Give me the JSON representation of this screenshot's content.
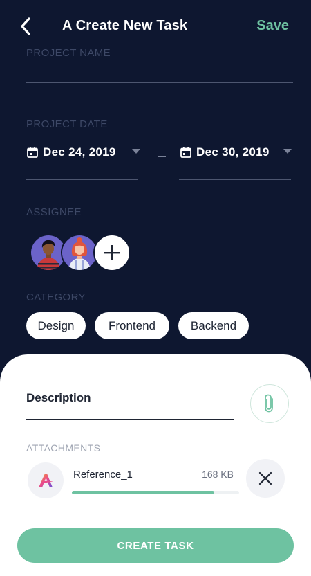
{
  "header": {
    "title": "A Create New Task",
    "save_label": "Save",
    "back_icon": "chevron-left-icon"
  },
  "form": {
    "project_name_label": "PROJECT NAME",
    "project_date_label": "PROJECT DATE",
    "start_date": "Dec 24, 2019",
    "end_date": "Dec 30, 2019",
    "assignee_label": "ASSIGNEE",
    "category_label": "CATEGORY",
    "categories": [
      "Design",
      "Frontend",
      "Backend"
    ]
  },
  "sheet": {
    "description_label": "Description",
    "attachments_label": "ATTACHMENTS",
    "attachment": {
      "name": "Reference_1",
      "size": "168 KB",
      "progress": 0.85
    },
    "create_label": "CREATE TASK"
  },
  "colors": {
    "background": "#0e1730",
    "accent": "#6ec2a1",
    "muted_label": "#3d4866"
  }
}
